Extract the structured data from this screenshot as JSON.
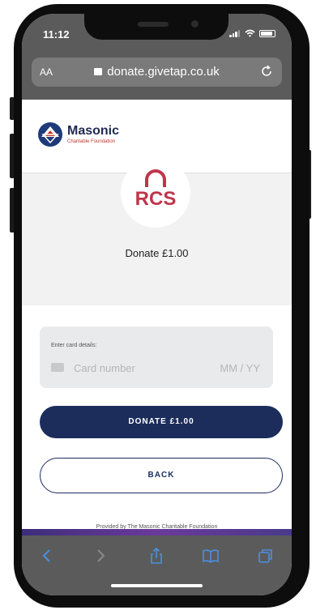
{
  "status_bar": {
    "time": "11:12"
  },
  "browser": {
    "text_size_label": "AA",
    "url": "donate.givetap.co.uk"
  },
  "org": {
    "name": "Masonic",
    "subtitle": "Charitable Foundation"
  },
  "badge": {
    "mark_text": "RCS"
  },
  "donation": {
    "heading": "Donate £1.00",
    "card_label": "Enter card details:",
    "card_placeholder": "Card number",
    "expiry_placeholder": "MM / YY",
    "donate_button": "DONATE £1.00",
    "back_button": "BACK",
    "provided_by": "Provided by The Masonic Charitable Foundation"
  },
  "toolbar": {
    "items": [
      "back-icon",
      "forward-icon",
      "share-icon",
      "bookmarks-icon",
      "tabs-icon"
    ]
  },
  "colors": {
    "navy": "#1c2d5c",
    "brand_red": "#c0392b",
    "badge_red": "#c0354a",
    "chrome_gray": "#5b5b5b"
  }
}
